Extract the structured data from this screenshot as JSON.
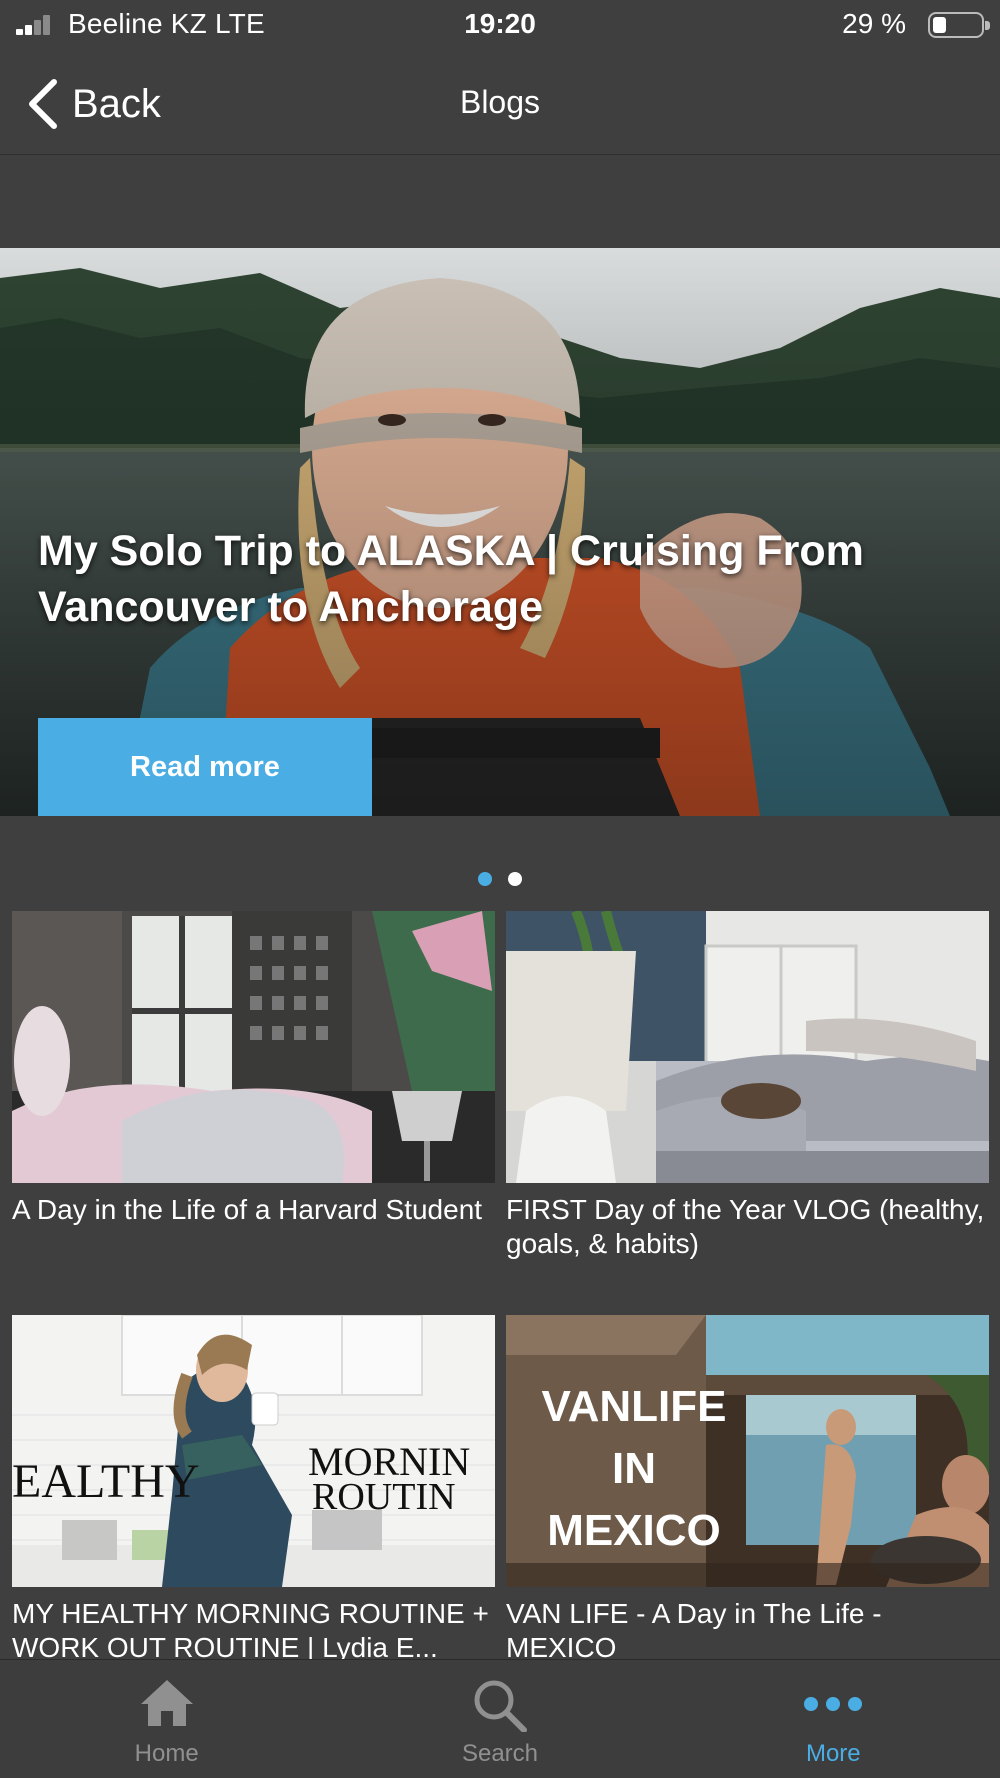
{
  "status_bar": {
    "carrier": "Beeline KZ  LTE",
    "time": "19:20",
    "battery": "29 %",
    "battery_level": 0.29
  },
  "nav": {
    "back_label": "Back",
    "title": "Blogs"
  },
  "hero": {
    "title": "My Solo Trip to ALASKA | Cruising From Vancouver to Anchorage",
    "button_label": "Read more"
  },
  "carousel": {
    "page_count": 2,
    "active_index": 0
  },
  "posts": [
    {
      "title": "A Day in the Life of a Harvard Student"
    },
    {
      "title": "FIRST Day of the Year VLOG (healthy, goals, & habits)"
    },
    {
      "title": "MY HEALTHY MORNING ROUTINE + WORK OUT ROUTINE | Lydia E..."
    },
    {
      "title": "VAN LIFE - A Day in The Life - MEXICO"
    }
  ],
  "thumb_text": {
    "morning_left": "EALTHY",
    "morning_right_1": "MORNIN",
    "morning_right_2": "ROUTIN",
    "vanlife_1": "VANLIFE",
    "vanlife_2": "IN",
    "vanlife_3": "MEXICO"
  },
  "tabs": [
    {
      "label": "Home",
      "icon": "home-icon"
    },
    {
      "label": "Search",
      "icon": "search-icon"
    },
    {
      "label": "More",
      "icon": "more-icon",
      "active": true
    }
  ],
  "colors": {
    "background": "#3f3f40",
    "accent": "#4aaee4",
    "tab_inactive": "#909090"
  }
}
